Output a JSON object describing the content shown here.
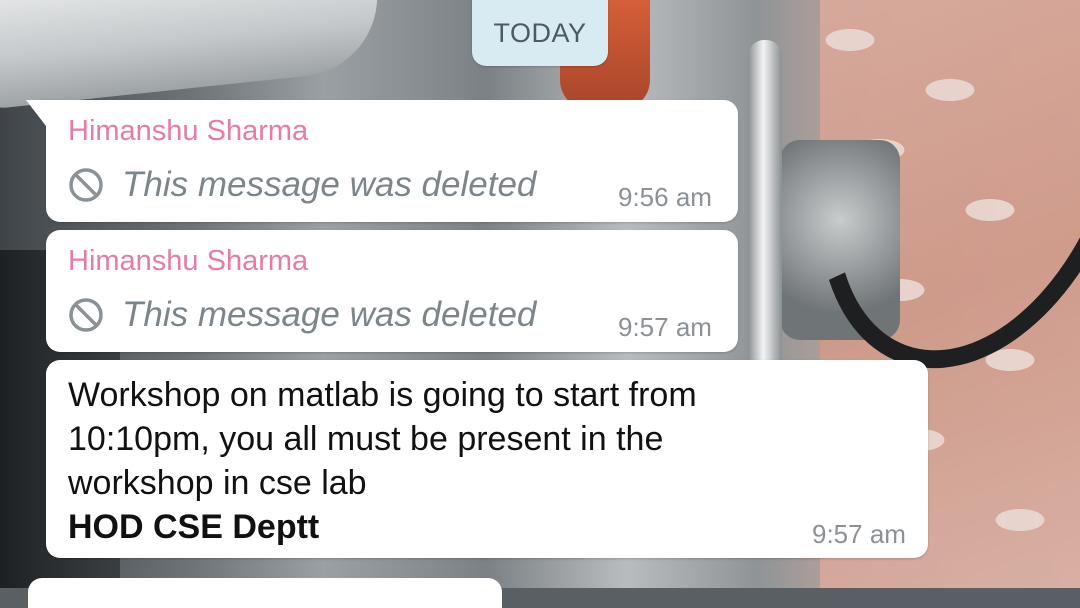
{
  "date_chip": {
    "label": "TODAY"
  },
  "messages": [
    {
      "sender": "Himanshu Sharma",
      "text": "This message was deleted",
      "time": "9:56 am",
      "deleted": true
    },
    {
      "sender": "Himanshu Sharma",
      "text": "This message was deleted",
      "time": "9:57 am",
      "deleted": true
    },
    {
      "sender": "",
      "lines": [
        "Workshop on matlab is going to start from",
        "10:10pm, you all must be present in the",
        "workshop in cse lab"
      ],
      "signature": "HOD CSE Deptt",
      "time": "9:57 am",
      "deleted": false
    }
  ],
  "colors": {
    "sender": "#e77ba8",
    "bubble": "#ffffff",
    "date_chip": "#d8eaf2",
    "deleted_text": "#7c858a",
    "time": "#8b9195"
  },
  "icons": {
    "deleted": "ban-icon"
  }
}
